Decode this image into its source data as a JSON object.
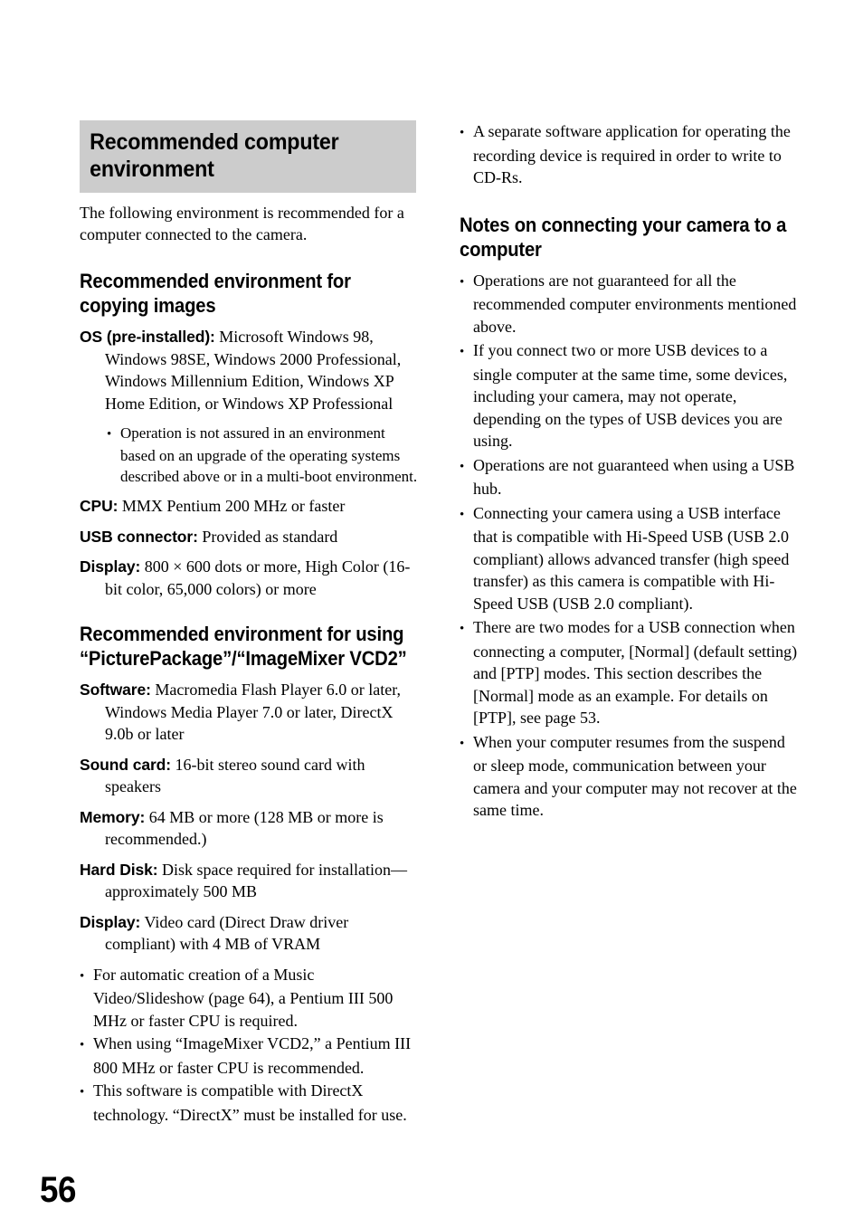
{
  "page": {
    "number": "56"
  },
  "left_column": {
    "main_heading": "Recommended computer environment",
    "intro": "The following environment is recommended for a computer connected to the camera.",
    "section_copying": {
      "heading": "Recommended environment for copying images",
      "entries": [
        {
          "term": "OS (pre-installed):",
          "value": "Microsoft Windows 98, Windows 98SE, Windows 2000 Professional, Windows Millennium Edition, Windows XP Home Edition, or Windows XP Professional"
        },
        {
          "term": "CPU:",
          "value": "MMX Pentium 200 MHz or faster"
        },
        {
          "term": "USB connector:",
          "value": "Provided as standard"
        },
        {
          "term": "Display:",
          "value": "800 × 600 dots or more, High Color (16-bit color, 65,000 colors) or more"
        }
      ],
      "os_notes": [
        "Operation is not assured in an environment based on an upgrade of the operating systems described above or in a multi-boot environment."
      ]
    },
    "section_software": {
      "heading": "Recommended environment for using “PicturePackage”/“ImageMixer VCD2”",
      "entries": [
        {
          "term": "Software:",
          "value": "Macromedia Flash Player 6.0 or later, Windows Media Player 7.0 or later, DirectX 9.0b or later"
        },
        {
          "term": "Sound card:",
          "value": "16-bit stereo sound card with speakers"
        },
        {
          "term": "Memory:",
          "value": "64 MB or more (128 MB or more is recommended.)"
        },
        {
          "term": "Hard Disk:",
          "value": "Disk space required for installation—approximately 500 MB"
        },
        {
          "term": "Display:",
          "value": "Video card (Direct Draw driver compliant) with 4 MB of VRAM"
        }
      ],
      "notes": [
        "For automatic creation of a Music Video/Slideshow (page 64), a Pentium III 500 MHz or faster CPU is required.",
        "When using “ImageMixer VCD2,” a Pentium III 800 MHz or faster CPU is recommended.",
        "This software is compatible with DirectX technology. “DirectX” must be installed for use."
      ]
    }
  },
  "right_column": {
    "top_notes": [
      "A separate software application for operating the recording device is required in order to write to CD-Rs."
    ],
    "section_connecting": {
      "heading": "Notes on connecting your camera to a computer",
      "notes": [
        "Operations are not guaranteed for all the recommended computer environments mentioned above.",
        "If you connect two or more USB devices to a single computer at the same time, some devices, including your camera, may not operate, depending on the types of USB devices you are using.",
        "Operations are not guaranteed when using a USB hub.",
        "Connecting your camera using a USB interface that is compatible with Hi-Speed USB (USB 2.0 compliant) allows advanced transfer (high speed transfer) as this camera is compatible with Hi-Speed USB (USB 2.0 compliant).",
        "There are two modes for a USB connection when connecting a computer, [Normal] (default setting) and [PTP] modes. This section describes the [Normal] mode as an example. For details on [PTP], see page 53.",
        "When your computer resumes from the suspend or sleep mode, communication between your camera and your computer may not recover at the same time."
      ]
    }
  }
}
